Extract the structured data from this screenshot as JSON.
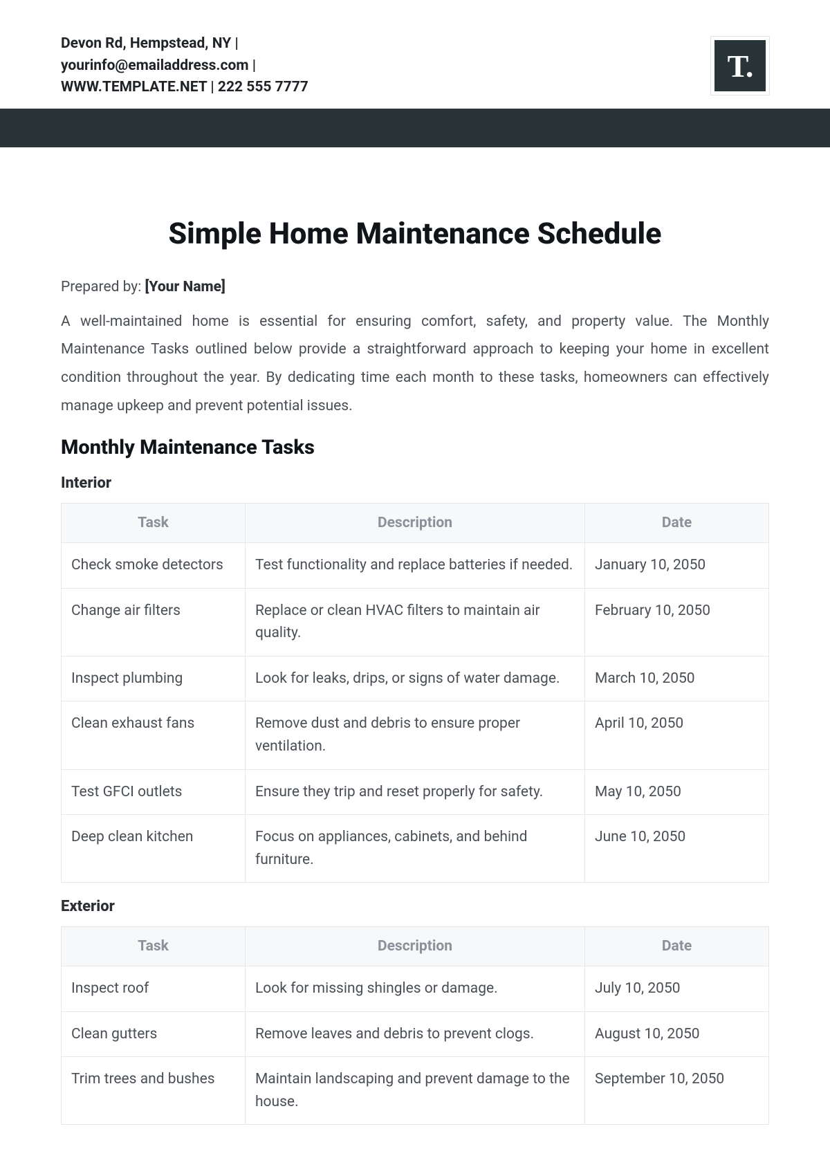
{
  "header": {
    "contact_line1": "Devon Rd, Hempstead, NY |",
    "contact_line2": "yourinfo@emailaddress.com |",
    "contact_line3": "WWW.TEMPLATE.NET | 222 555 7777",
    "logo_text": "T."
  },
  "title": "Simple Home Maintenance Schedule",
  "prepared_by_label": "Prepared by: ",
  "prepared_by_value": "[Your Name]",
  "intro": "A well-maintained home is essential for ensuring comfort, safety, and property value. The Monthly Maintenance Tasks outlined below provide a straightforward approach to keeping your home in excellent condition throughout the year. By dedicating time each month to these tasks, homeowners can effectively manage upkeep and prevent potential issues.",
  "section_title": "Monthly Maintenance Tasks",
  "columns": {
    "task": "Task",
    "description": "Description",
    "date": "Date"
  },
  "interior": {
    "heading": "Interior",
    "rows": [
      {
        "task": "Check smoke detectors",
        "description": "Test functionality and replace batteries if needed.",
        "date": "January 10, 2050"
      },
      {
        "task": "Change air filters",
        "description": "Replace or clean HVAC filters to maintain air quality.",
        "date": "February 10, 2050"
      },
      {
        "task": "Inspect plumbing",
        "description": "Look for leaks, drips, or signs of water damage.",
        "date": "March 10, 2050"
      },
      {
        "task": "Clean exhaust fans",
        "description": "Remove dust and debris to ensure proper ventilation.",
        "date": "April 10, 2050"
      },
      {
        "task": "Test GFCI outlets",
        "description": "Ensure they trip and reset properly for safety.",
        "date": "May 10, 2050"
      },
      {
        "task": "Deep clean kitchen",
        "description": "Focus on appliances, cabinets, and behind furniture.",
        "date": "June 10, 2050"
      }
    ]
  },
  "exterior": {
    "heading": "Exterior",
    "rows": [
      {
        "task": "Inspect roof",
        "description": "Look for missing shingles or damage.",
        "date": "July 10, 2050"
      },
      {
        "task": "Clean gutters",
        "description": "Remove leaves and debris to prevent clogs.",
        "date": "August 10, 2050"
      },
      {
        "task": "Trim trees and bushes",
        "description": "Maintain landscaping and prevent damage to the house.",
        "date": "September 10, 2050"
      }
    ]
  }
}
